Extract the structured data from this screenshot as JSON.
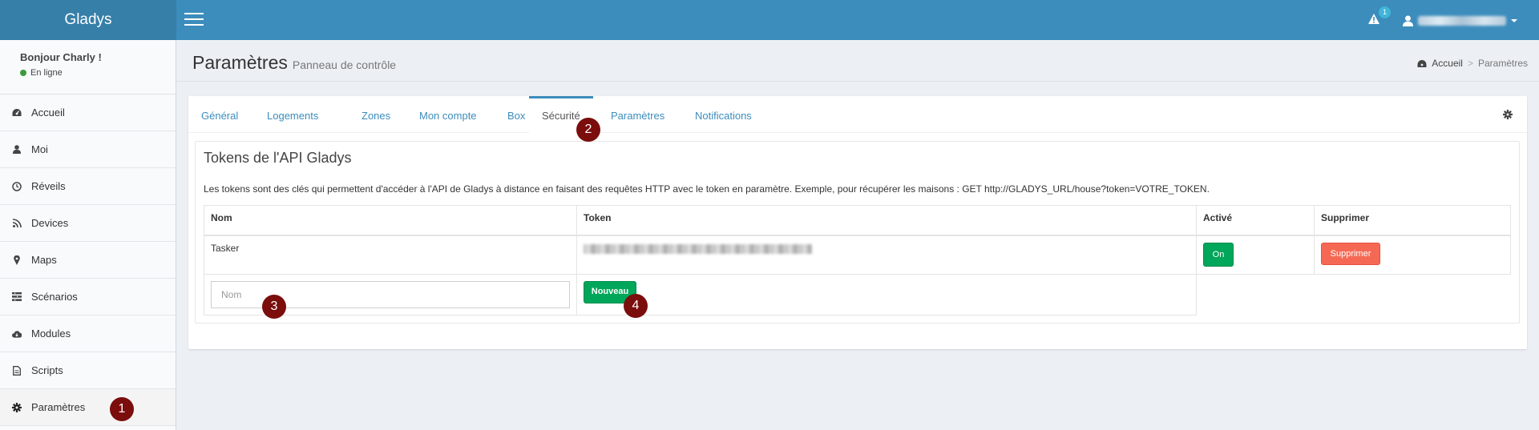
{
  "app": {
    "brand": "Gladys"
  },
  "header": {
    "notification_count": "1",
    "icons": {
      "menu": "hamburger-icon",
      "alert": "warning-icon",
      "user": "user-icon"
    }
  },
  "sidebar": {
    "greeting": "Bonjour Charly !",
    "status": "En ligne",
    "items": [
      {
        "label": "Accueil",
        "icon": "dashboard-icon"
      },
      {
        "label": "Moi",
        "icon": "user-icon"
      },
      {
        "label": "Réveils",
        "icon": "clock-icon"
      },
      {
        "label": "Devices",
        "icon": "rss-icon"
      },
      {
        "label": "Maps",
        "icon": "map-marker-icon"
      },
      {
        "label": "Scénarios",
        "icon": "list-icon"
      },
      {
        "label": "Modules",
        "icon": "cloud-download-icon"
      },
      {
        "label": "Scripts",
        "icon": "file-icon"
      },
      {
        "label": "Paramètres",
        "icon": "gear-icon"
      }
    ]
  },
  "content_header": {
    "title": "Paramètres",
    "subtitle": "Panneau de contrôle",
    "breadcrumb": [
      "Accueil",
      ">",
      "Paramètres"
    ]
  },
  "tabs": [
    "Général",
    "Logements",
    "Zones",
    "Mon compte",
    "Box",
    "Sécurité",
    "Paramètres",
    "Notifications"
  ],
  "active_tab": "Sécurité",
  "panel": {
    "title": "Tokens de l'API Gladys",
    "description": "Les tokens sont des clés qui permettent d'accéder à l'API de Gladys à distance en faisant des requêtes HTTP avec le token en paramètre. Exemple, pour récupérer les maisons : GET http://GLADYS_URL/house?token=VOTRE_TOKEN.",
    "columns": [
      "Nom",
      "Token",
      "Activé",
      "Supprimer"
    ],
    "rows": [
      {
        "name": "Tasker",
        "active_label": "On",
        "delete_label": "Supprimer"
      }
    ],
    "new_row": {
      "name_placeholder": "Nom",
      "new_label": "Nouveau"
    }
  },
  "markers": [
    "1",
    "2",
    "3",
    "4"
  ],
  "colors": {
    "header": "#3c8dbc",
    "brand_bg": "#367fa9",
    "success": "#00a65a",
    "danger": "#f56954",
    "marker": "#7b0d0d"
  }
}
